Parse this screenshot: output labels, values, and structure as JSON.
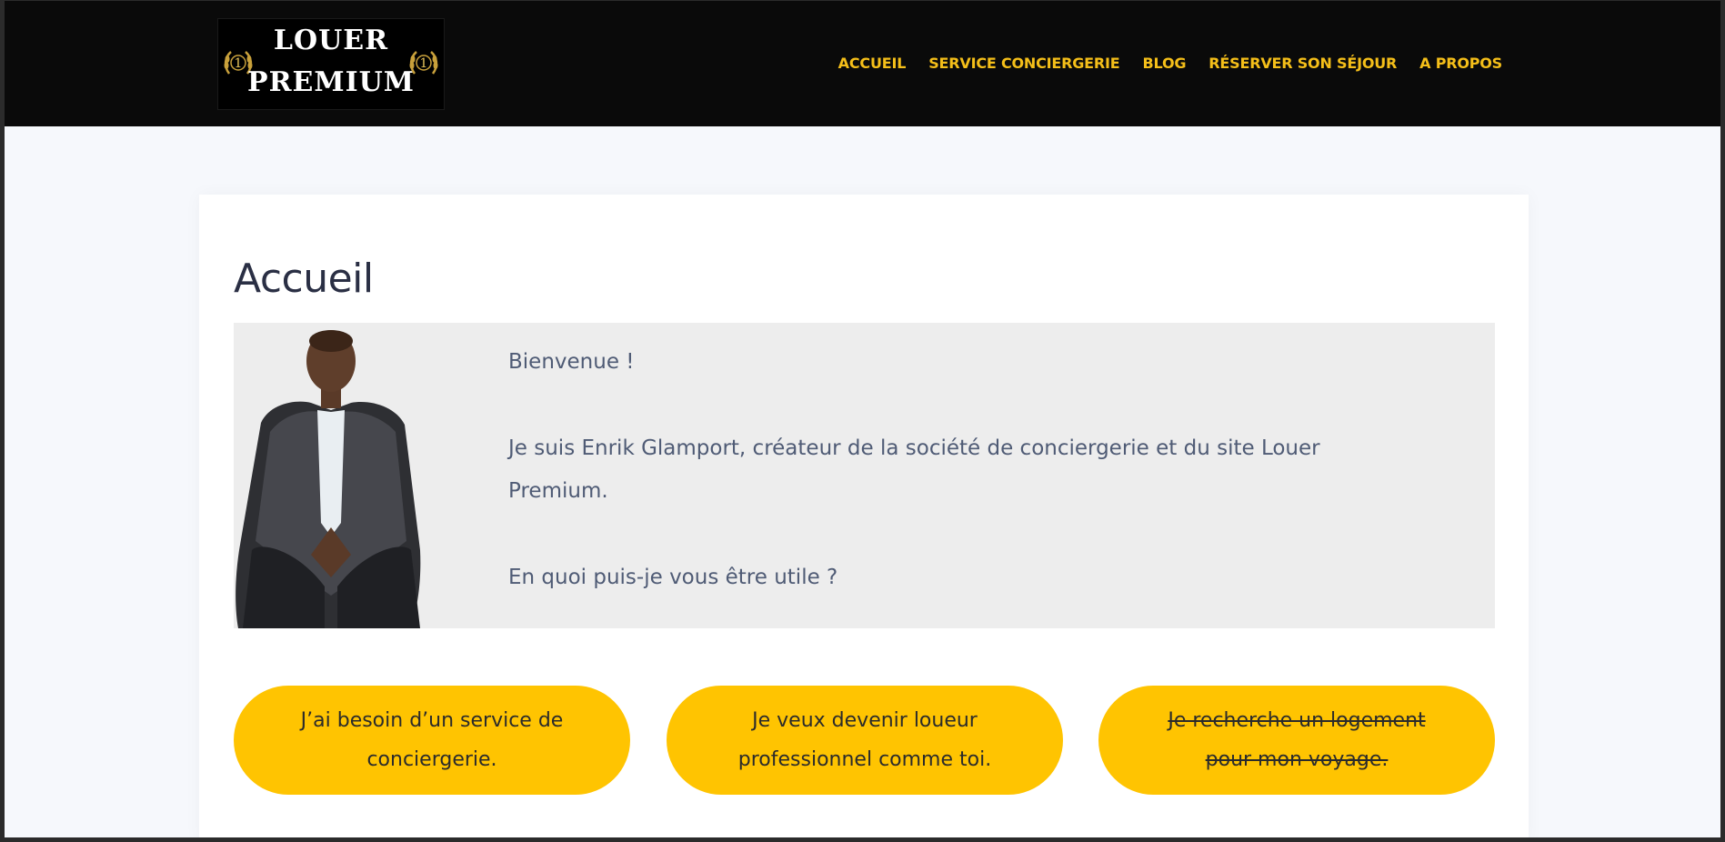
{
  "header": {
    "logo": {
      "line1": "LOUER",
      "line2": "PREMIUM",
      "badge": "1"
    },
    "nav": [
      {
        "label": "ACCUEIL"
      },
      {
        "label": "SERVICE CONCIERGERIE"
      },
      {
        "label": "BLOG"
      },
      {
        "label": "RÉSERVER SON SÉJOUR"
      },
      {
        "label": "A PROPOS"
      }
    ],
    "accent_color": "#f5bf19",
    "background_color": "#0a0a0a"
  },
  "main": {
    "title": "Accueil",
    "intro": {
      "greeting": "Bienvenue !",
      "body": "Je suis Enrik Glamport, créateur de la société de conciergerie et du site Louer Premium.",
      "question": "En quoi puis-je vous être utile ?"
    },
    "buttons": [
      {
        "label": "J’ai besoin d’un service de conciergerie."
      },
      {
        "label": "Je veux devenir loueur professionnel comme toi."
      },
      {
        "label": "Je recherche un logement pour mon voyage."
      }
    ],
    "button_color": "#ffc401"
  }
}
